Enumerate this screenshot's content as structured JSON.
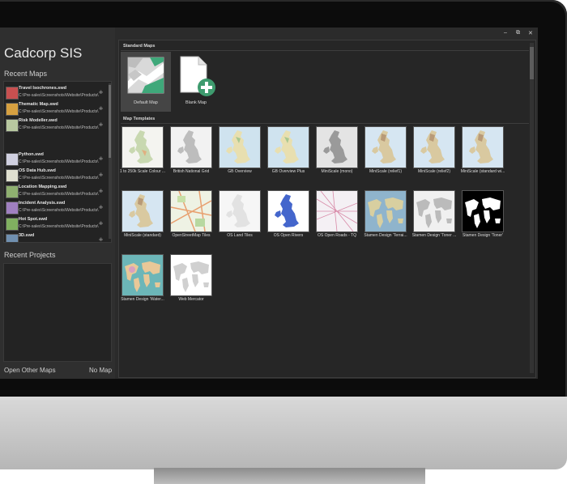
{
  "app": {
    "title": "Cadcorp SIS"
  },
  "window_controls": {
    "minimize": "–",
    "restore": "⧉",
    "close": "✕"
  },
  "left": {
    "recent_maps_title": "Recent Maps",
    "recent_maps": [
      {
        "name": "Travel Isochrones.swd",
        "path": "C:\\Pre-sales\\Screenshots\\Website\\Products\\",
        "color": "#c75050"
      },
      {
        "name": "Thematic Map.swd",
        "path": "C:\\Pre-sales\\Screenshots\\Website\\Products\\",
        "color": "#d6a040"
      },
      {
        "name": "Risk Modeller.swd",
        "path": "C:\\Pre-sales\\Screenshots\\Website\\Products\\",
        "color": "#b8c8a0"
      },
      {
        "name": "Python.swd",
        "path": "C:\\Pre-sales\\Screenshots\\Website\\Products\\",
        "color": "#d0d0e0"
      },
      {
        "name": "OS Data Hub.swd",
        "path": "C:\\Pre-sales\\Screenshots\\Website\\Products\\",
        "color": "#e0e0d0"
      },
      {
        "name": "Location Mapping.swd",
        "path": "C:\\Pre-sales\\Screenshots\\Website\\Products\\",
        "color": "#8fb070"
      },
      {
        "name": "Incident Analysis.swd",
        "path": "C:\\Pre-sales\\Screenshots\\Website\\Products\\",
        "color": "#a080c0"
      },
      {
        "name": "Hot Spot.swd",
        "path": "C:\\Pre-sales\\Screenshots\\Website\\Products\\",
        "color": "#80b060"
      },
      {
        "name": "3D.swd",
        "path": "",
        "color": "#7090b0"
      }
    ],
    "recent_projects_title": "Recent Projects",
    "open_other_maps": "Open Other Maps",
    "no_map": "No Map"
  },
  "standard_maps": {
    "label": "Standard Maps",
    "items": [
      {
        "caption": "Default Map",
        "icon": "map-icon"
      },
      {
        "caption": "Blank Map",
        "icon": "blank-map-add-icon"
      }
    ]
  },
  "templates": {
    "label": "Map Templates",
    "items": [
      {
        "caption": "1 to 250k Scale Colour ...",
        "style": "uk-color"
      },
      {
        "caption": "British National Grid",
        "style": "uk-grey"
      },
      {
        "caption": "GB Overview",
        "style": "uk-overview"
      },
      {
        "caption": "GB Overview Plus",
        "style": "uk-overview"
      },
      {
        "caption": "MiniScale (mono)",
        "style": "uk-mono"
      },
      {
        "caption": "MiniScale (relief1)",
        "style": "uk-relief"
      },
      {
        "caption": "MiniScale (relief2)",
        "style": "uk-relief"
      },
      {
        "caption": "MiniScale (standard wi...",
        "style": "uk-relief"
      },
      {
        "caption": "MiniScale (standard)",
        "style": "uk-relief"
      },
      {
        "caption": "OpenStreetMap Tiles",
        "style": "osm"
      },
      {
        "caption": "OS Land Tiles",
        "style": "uk-light"
      },
      {
        "caption": "OS Open Rivers",
        "style": "uk-blue"
      },
      {
        "caption": "OS Open Roads - TQ",
        "style": "roads"
      },
      {
        "caption": "Stamen Design 'Terrai...",
        "style": "world-terrain"
      },
      {
        "caption": "Stamen Design 'Toner ...",
        "style": "world-grey"
      },
      {
        "caption": "Stamen Design 'Toner'",
        "style": "world-bw"
      },
      {
        "caption": "Stamen Design 'Water...",
        "style": "world-water"
      },
      {
        "caption": "Web Mercator",
        "style": "world-light"
      }
    ]
  }
}
